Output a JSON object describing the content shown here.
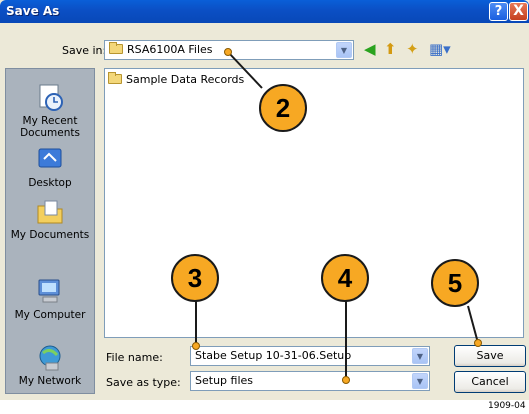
{
  "window": {
    "title": "Save As",
    "help_glyph": "?",
    "close_glyph": "X"
  },
  "toolbar": {
    "save_in_label": "Save in:",
    "save_in_value": "RSA6100A Files",
    "icons": [
      "back-icon",
      "up-folder-icon",
      "new-folder-icon",
      "views-menu-icon"
    ]
  },
  "places": [
    {
      "label": "My Recent Documents",
      "icon": "recent-documents-icon"
    },
    {
      "label": "Desktop",
      "icon": "desktop-icon"
    },
    {
      "label": "My Documents",
      "icon": "my-documents-icon"
    },
    {
      "label": "My Computer",
      "icon": "my-computer-icon"
    },
    {
      "label": "My Network",
      "icon": "my-network-icon"
    }
  ],
  "file_list": {
    "items": [
      {
        "name": "Sample Data Records",
        "icon": "folder-icon"
      }
    ]
  },
  "form": {
    "file_name_label": "File name:",
    "file_name_value": "Stabe Setup 10-31-06.Setup",
    "save_as_type_label": "Save as type:",
    "save_as_type_value": "Setup files"
  },
  "buttons": {
    "save": "Save",
    "cancel": "Cancel"
  },
  "callouts": [
    "2",
    "3",
    "4",
    "5"
  ],
  "accent_colors": {
    "titlebar": "#0b4fc4",
    "callout": "#f7a823"
  },
  "figure_number": "1909-04"
}
